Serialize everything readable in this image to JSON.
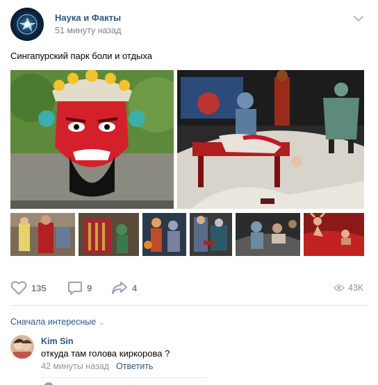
{
  "post": {
    "group_name": "Наука и Факты",
    "time": "51 минуту назад",
    "text": "Сингапурский парк боли и отдыха",
    "photos": [
      {
        "description": "red demon face statue with crown"
      },
      {
        "description": "blue demon figures with red bench"
      },
      {
        "description": "thumbnail 1"
      },
      {
        "description": "thumbnail 2"
      },
      {
        "description": "thumbnail 3"
      },
      {
        "description": "thumbnail 4"
      },
      {
        "description": "thumbnail 5"
      },
      {
        "description": "thumbnail 6"
      }
    ]
  },
  "actions": {
    "likes": "135",
    "comments": "9",
    "shares": "4",
    "views": "43K"
  },
  "comments": {
    "sort_label": "Сначала интересные",
    "items": [
      {
        "author": "Kim Sin",
        "text": "откуда там голова киркорова ?",
        "time": "42 минуты назад",
        "reply_label": "Ответить"
      }
    ]
  },
  "colors": {
    "link": "#2a5885",
    "muted": "#828282",
    "divider": "#e7e8ec"
  }
}
